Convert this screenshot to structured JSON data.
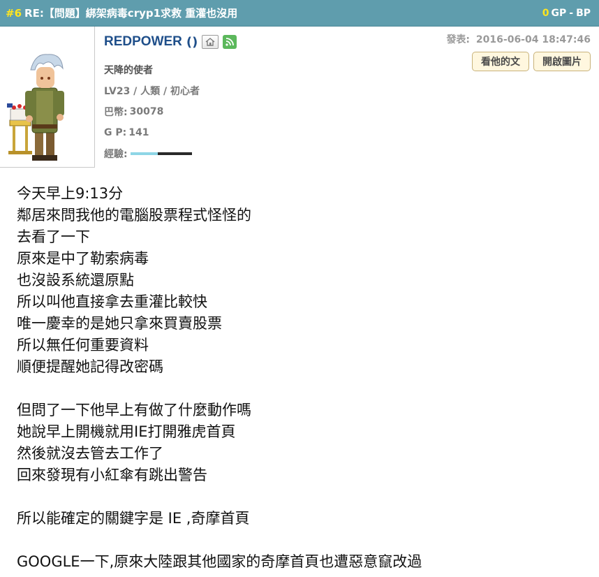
{
  "header": {
    "floor": "#6",
    "title": "RE:【問題】綁架病毒cryp1求救 重灌也沒用",
    "gp_value": "0",
    "gp_label": "GP",
    "separator": "-",
    "bp_label": "BP"
  },
  "author": {
    "username": "REDPOWER",
    "paren": "()",
    "home_icon": "home-icon",
    "rss_icon": "rss-icon",
    "title": "天降的使者",
    "level_line": "LV23 / 人類 / 初心者",
    "coins_label": "巴幣:",
    "coins": "30078",
    "gp_label": "G P:",
    "gp": "141",
    "exp_label": "經驗:",
    "exp_progress": 0.45
  },
  "post": {
    "time_label": "發表:",
    "time": "2016-06-04 18:47:46",
    "buttons": [
      "看他的文",
      "開啟圖片"
    ]
  },
  "content": {
    "paragraphs": [
      [
        "今天早上9:13分",
        "鄰居來問我他的電腦股票程式怪怪的",
        "去看了一下",
        "原來是中了勒索病毒",
        "也沒設系統還原點",
        "所以叫他直接拿去重灌比較快",
        "唯一慶幸的是她只拿來買賣股票",
        "所以無任何重要資料",
        "順便提醒她記得改密碼"
      ],
      [
        "但問了一下他早上有做了什麼動作嗎",
        "她說早上開機就用IE打開雅虎首頁",
        "然後就沒去管去工作了",
        "回來發現有小紅傘有跳出警告"
      ],
      [
        "所以能確定的關鍵字是 IE ,奇摩首頁"
      ],
      [
        "GOOGLE一下,原來大陸跟其他國家的奇摩首頁也遭惡意竄改過"
      ]
    ]
  },
  "colors": {
    "topbar": "#5f9dad",
    "floor": "#ffe51f",
    "username": "#1f4f8a",
    "button_bg": "#fff7df"
  }
}
